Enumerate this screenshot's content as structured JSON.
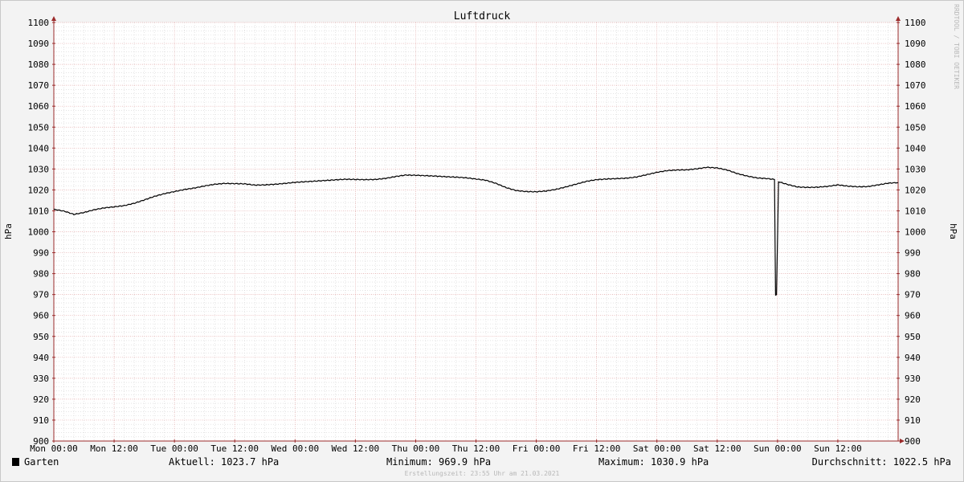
{
  "colors": {
    "canvas_bg": "#f3f3f3",
    "plot_bg": "#ffffff",
    "major_grid": "#e2a6a6",
    "minor_grid": "#d4d4d4",
    "axis": "#9b2b2b",
    "line": "#000000",
    "text": "#000000",
    "watermark": "#b8b8b8"
  },
  "watermark": "RRDTOOL / TOBI OETIKER",
  "footer": {
    "legend_label": "Garten",
    "current": "Aktuell: 1023.7 hPa",
    "minimum": "Minimum: 969.9 hPa",
    "maximum": "Maximum: 1030.9 hPa",
    "average": "Durchschnitt: 1022.5 hPa",
    "created": "Erstellungszeit: 23:55 Uhr am 21.03.2021"
  },
  "chart_data": {
    "type": "line",
    "title": "Luftdruck",
    "ylabel": "hPa",
    "ylabel_right": "hPa",
    "ylim": [
      900,
      1100
    ],
    "xlim": [
      0,
      168
    ],
    "y_ticks": [
      900,
      910,
      920,
      930,
      940,
      950,
      960,
      970,
      980,
      990,
      1000,
      1010,
      1020,
      1030,
      1040,
      1050,
      1060,
      1070,
      1080,
      1090,
      1100
    ],
    "x_ticks": [
      {
        "hour": 0,
        "label": "Mon 00:00"
      },
      {
        "hour": 12,
        "label": "Mon 12:00"
      },
      {
        "hour": 24,
        "label": "Tue 00:00"
      },
      {
        "hour": 36,
        "label": "Tue 12:00"
      },
      {
        "hour": 48,
        "label": "Wed 00:00"
      },
      {
        "hour": 60,
        "label": "Wed 12:00"
      },
      {
        "hour": 72,
        "label": "Thu 00:00"
      },
      {
        "hour": 84,
        "label": "Thu 12:00"
      },
      {
        "hour": 96,
        "label": "Fri 00:00"
      },
      {
        "hour": 108,
        "label": "Fri 12:00"
      },
      {
        "hour": 120,
        "label": "Sat 00:00"
      },
      {
        "hour": 132,
        "label": "Sat 12:00"
      },
      {
        "hour": 144,
        "label": "Sun 00:00"
      },
      {
        "hour": 156,
        "label": "Sun 12:00"
      }
    ],
    "grid": true,
    "series": [
      {
        "name": "Garten",
        "color": "#000000",
        "x": [
          0,
          2,
          4,
          6,
          8,
          10,
          12,
          14,
          16,
          18,
          20,
          22,
          24,
          26,
          28,
          30,
          32,
          34,
          36,
          38,
          40,
          42,
          44,
          46,
          48,
          50,
          52,
          54,
          56,
          58,
          60,
          62,
          64,
          66,
          68,
          70,
          72,
          74,
          76,
          78,
          80,
          82,
          84,
          86,
          88,
          90,
          92,
          94,
          96,
          98,
          100,
          102,
          104,
          106,
          108,
          110,
          112,
          114,
          116,
          118,
          120,
          122,
          124,
          126,
          128,
          130,
          132,
          134,
          136,
          138,
          140,
          142,
          143.4,
          143.6,
          143.8,
          144.2,
          146,
          148,
          150,
          152,
          154,
          156,
          158,
          160,
          162,
          164,
          166,
          168
        ],
        "y": [
          1010.7,
          1009.9,
          1008.3,
          1009.2,
          1010.5,
          1011.4,
          1011.9,
          1012.5,
          1013.6,
          1015.2,
          1016.9,
          1018.2,
          1019.2,
          1020.2,
          1020.9,
          1021.9,
          1022.7,
          1023.1,
          1023.0,
          1022.9,
          1022.3,
          1022.4,
          1022.7,
          1023.1,
          1023.6,
          1023.9,
          1024.2,
          1024.5,
          1024.8,
          1025.1,
          1025.0,
          1024.9,
          1025.0,
          1025.5,
          1026.4,
          1027.1,
          1027.0,
          1026.8,
          1026.6,
          1026.3,
          1026.1,
          1025.8,
          1025.2,
          1024.6,
          1023.1,
          1021.1,
          1019.7,
          1019.2,
          1019.1,
          1019.5,
          1020.3,
          1021.5,
          1022.8,
          1024.1,
          1024.9,
          1025.2,
          1025.4,
          1025.6,
          1026.2,
          1027.3,
          1028.4,
          1029.2,
          1029.5,
          1029.6,
          1030.1,
          1030.8,
          1030.5,
          1029.5,
          1027.8,
          1026.6,
          1025.7,
          1025.4,
          1025.0,
          969.9,
          969.9,
          1023.9,
          1022.6,
          1021.4,
          1021.2,
          1021.3,
          1021.7,
          1022.4,
          1021.8,
          1021.5,
          1021.6,
          1022.4,
          1023.2,
          1023.5
        ]
      }
    ]
  }
}
